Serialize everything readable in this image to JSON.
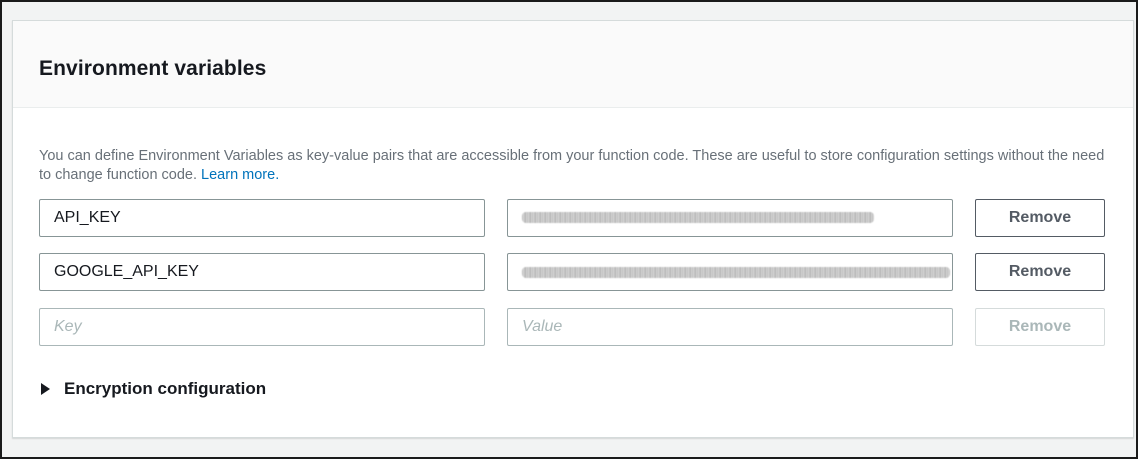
{
  "panel": {
    "title": "Environment variables",
    "description_text": "You can define Environment Variables as key-value pairs that are accessible from your function code. These are useful to store configuration settings without the need to change function code.",
    "learn_more_label": "Learn more."
  },
  "variables": [
    {
      "key": "API_KEY",
      "value_masked": true,
      "remove_label": "Remove"
    },
    {
      "key": "GOOGLE_API_KEY",
      "value_masked": true,
      "remove_label": "Remove"
    }
  ],
  "new_row": {
    "key_placeholder": "Key",
    "value_placeholder": "Value",
    "remove_label": "Remove",
    "remove_disabled": true
  },
  "encryption": {
    "label": "Encryption configuration",
    "icon": "caret-right-icon",
    "expanded": false
  },
  "colors": {
    "title": "#16191f",
    "description": "#687078",
    "link": "#0073bb",
    "field_border": "#879596",
    "button_border": "#545b64",
    "disabled": "#aab7b8"
  }
}
